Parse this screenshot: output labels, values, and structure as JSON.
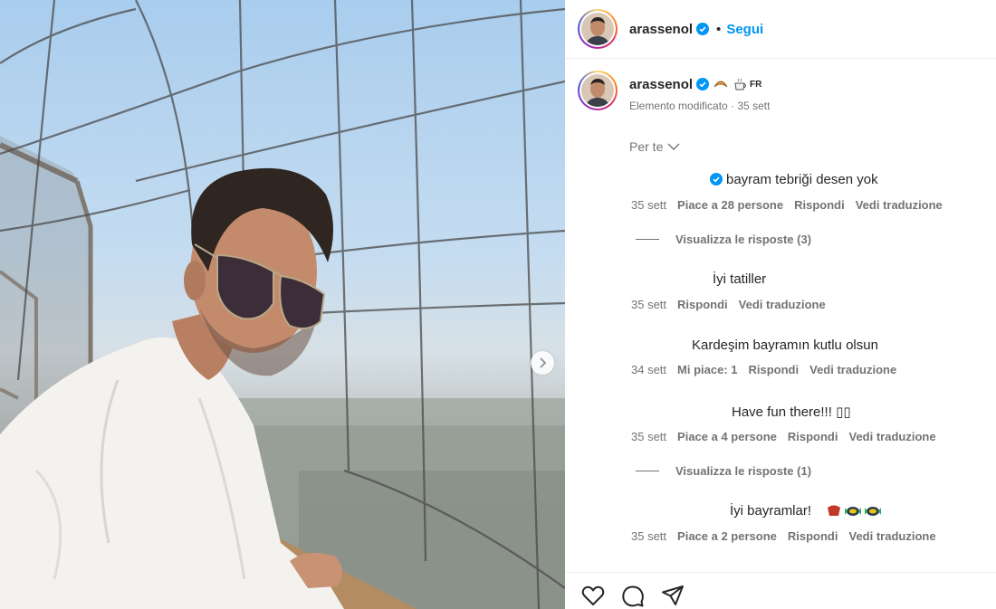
{
  "post": {
    "username": "arassenol",
    "follow_label": "Segui",
    "separator": "•",
    "caption_country": "FR",
    "edited_label": "Elemento modificato · 35 sett",
    "sort_label": "Per te"
  },
  "comments": [
    {
      "text": "bayram tebriği desen yok",
      "verified": true,
      "meta": [
        "35 sett",
        "Piace a 28 persone",
        "Rispondi",
        "Vedi traduzione"
      ],
      "replies": "Visualizza le risposte (3)"
    },
    {
      "text": "İyi tatiller",
      "meta": [
        "35 sett",
        "Rispondi",
        "Vedi traduzione"
      ]
    },
    {
      "text": "Kardeşim bayramın kutlu olsun",
      "meta": [
        "34 sett",
        "Mi piace: 1",
        "Rispondi",
        "Vedi traduzione"
      ]
    },
    {
      "text": "Have fun there!!! ▯▯",
      "meta": [
        "35 sett",
        "Piace a 4 persone",
        "Rispondi",
        "Vedi traduzione"
      ],
      "replies": "Visualizza le risposte (1)"
    },
    {
      "text": "İyi bayramlar!",
      "meta": [
        "35 sett",
        "Piace a 2 persone",
        "Rispondi",
        "Vedi traduzione"
      ]
    }
  ],
  "icons": {
    "like": "heart-icon",
    "comment": "comment-icon",
    "share": "share-icon",
    "verified": "verified-badge-icon",
    "next": "chevron-right-icon",
    "sort": "chevron-down-icon"
  },
  "colors": {
    "accent": "#0095f6",
    "text": "#262626",
    "muted": "#737373",
    "divider": "#efefef"
  }
}
